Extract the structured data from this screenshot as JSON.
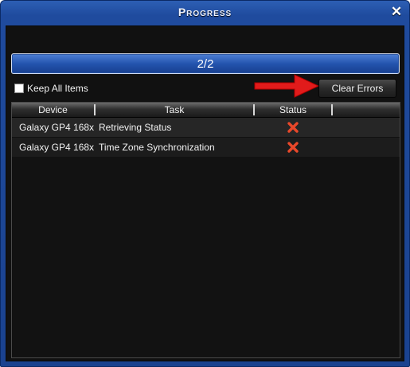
{
  "window": {
    "title": "Progress",
    "close_symbol": "✕"
  },
  "progress": {
    "label": "2/2",
    "fraction": 1.0
  },
  "keep_all_items": {
    "label": "Keep All Items",
    "checked": false
  },
  "clear_errors_button": {
    "label": "Clear Errors"
  },
  "table": {
    "columns": [
      "Device",
      "Task",
      "Status",
      ""
    ],
    "rows": [
      {
        "device": "Galaxy GP4 168x",
        "task": "Retrieving Status",
        "status": "error"
      },
      {
        "device": "Galaxy GP4 168x",
        "task": "Time Zone Synchronization",
        "status": "error"
      }
    ]
  },
  "colors": {
    "title_bar": "#1f4b9e",
    "panel_bg": "#111111",
    "error_x": "#e8482a",
    "annotation_arrow": "#e11b1b"
  },
  "icons": {
    "close": "close-icon",
    "status_error": "error-x-icon",
    "annotation": "red-arrow-icon"
  }
}
